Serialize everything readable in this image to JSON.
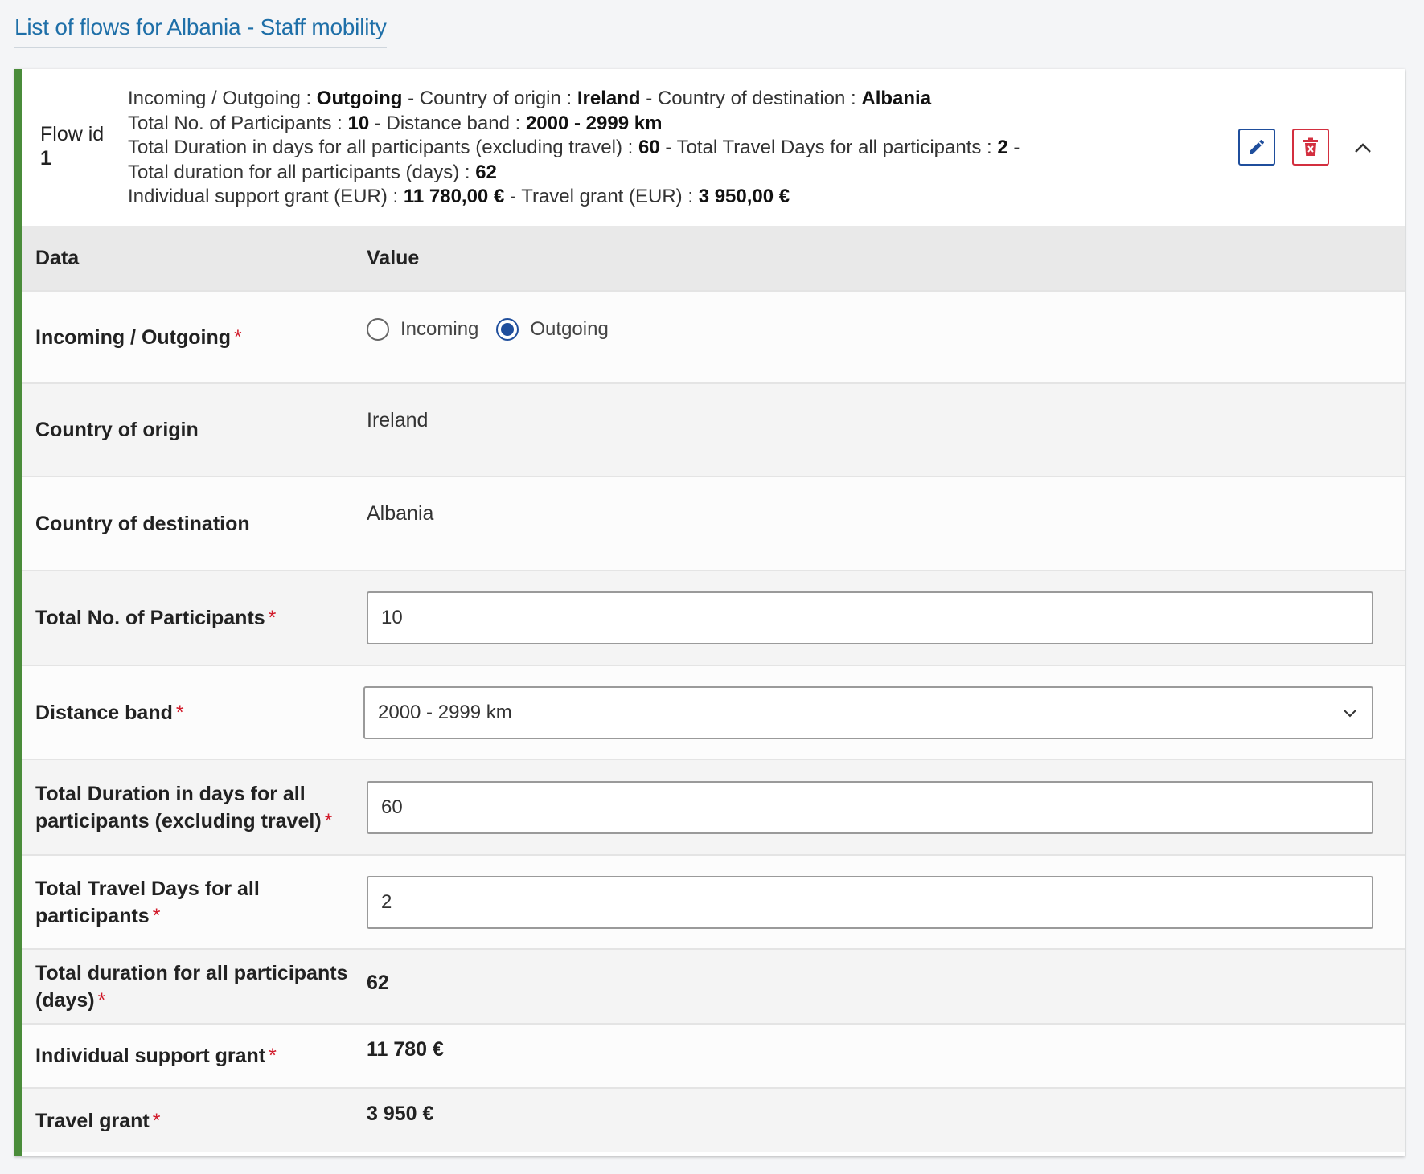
{
  "page": {
    "title": "List of flows for Albania - Staff mobility"
  },
  "flow": {
    "id_label": "Flow id",
    "id_value": "1",
    "summary": {
      "l1": [
        "Incoming / Outgoing : ",
        "Outgoing",
        " - Country of origin : ",
        "Ireland",
        " - Country of destination : ",
        "Albania"
      ],
      "l2": [
        "Total No. of Participants : ",
        "10",
        " - Distance band : ",
        "2000 - 2999 km"
      ],
      "l3": [
        "Total Duration in days for all participants (excluding travel) : ",
        "60",
        " - Total Travel Days for all participants : ",
        "2",
        " -"
      ],
      "l4": [
        "Total duration for all participants (days) : ",
        "62"
      ],
      "l5": [
        "Individual support grant (EUR) : ",
        "11 780,00 €",
        " - Travel grant (EUR) : ",
        "3 950,00 €"
      ]
    },
    "actions": {
      "edit_icon": "pencil-icon",
      "delete_icon": "trash-icon",
      "collapse_icon": "chevron-up-icon"
    }
  },
  "table": {
    "headers": {
      "data": "Data",
      "value": "Value"
    },
    "rows": {
      "direction": {
        "label": "Incoming / Outgoing",
        "required": "*",
        "options": [
          "Incoming",
          "Outgoing"
        ],
        "selected": "Outgoing"
      },
      "origin": {
        "label": "Country of origin",
        "value": "Ireland"
      },
      "destination": {
        "label": "Country of destination",
        "value": "Albania"
      },
      "participants": {
        "label": "Total No. of Participants",
        "required": "*",
        "value": "10"
      },
      "distance": {
        "label": "Distance band",
        "required": "*",
        "value": "2000 - 2999 km"
      },
      "duration_l1": "Total Duration in days for all",
      "duration_l2": "participants (excluding travel)",
      "duration": {
        "required": "*",
        "value": "60"
      },
      "travel_l1": "Total Travel Days for all",
      "travel_l2": "participants",
      "travel": {
        "required": "*",
        "value": "2"
      },
      "total_l1": "Total duration for all participants",
      "total_l2": "(days)",
      "total": {
        "required": "*",
        "value": "62"
      },
      "support": {
        "label": "Individual support grant",
        "required": "*",
        "value": "11 780 €"
      },
      "travel_grant": {
        "label": "Travel grant",
        "required": "*",
        "value": "3 950 €"
      }
    }
  },
  "colors": {
    "accent_blue": "#1f4e9c",
    "title_blue": "#1e6fa8",
    "danger_red": "#d32f3f",
    "required_red": "#d11a2a",
    "border_green": "#4a8c3a"
  }
}
